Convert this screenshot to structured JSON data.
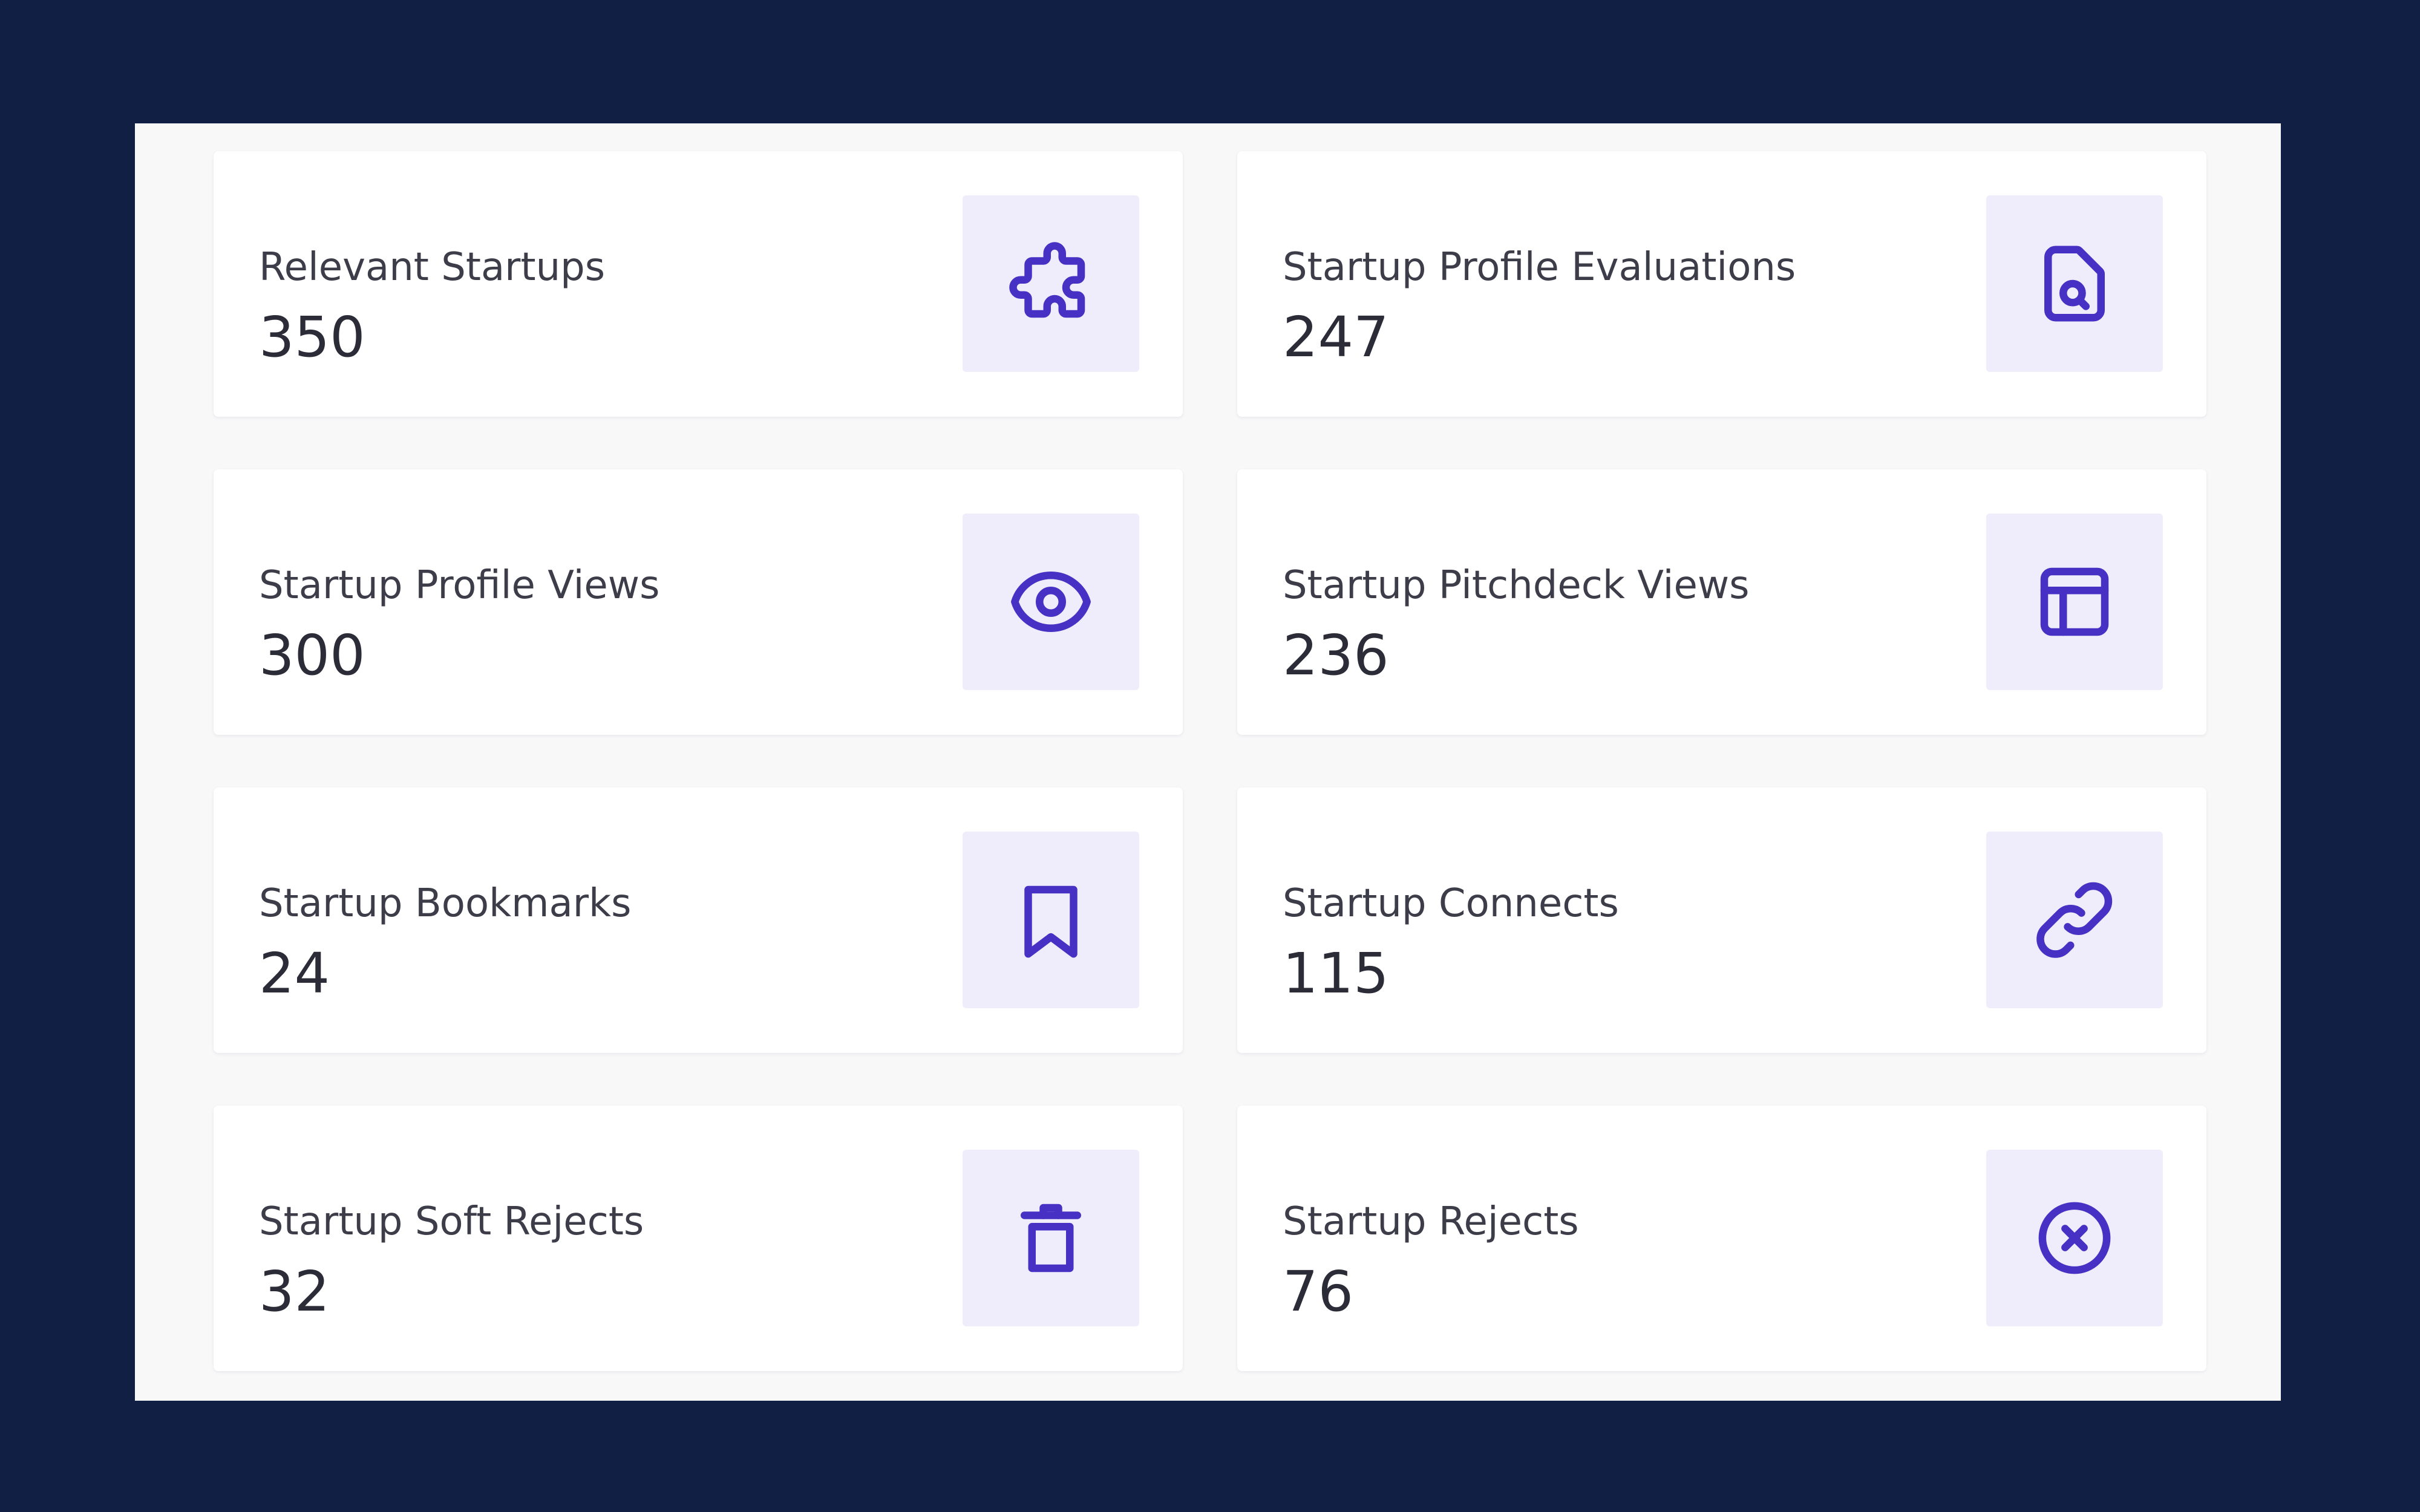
{
  "accent_color": "#4631c4",
  "icon_bg_color": "#efedfb",
  "background_color": "#121f45",
  "stats": [
    {
      "label": "Relevant Startups",
      "value": "350",
      "icon": "puzzle-icon"
    },
    {
      "label": "Startup Profile Evaluations",
      "value": "247",
      "icon": "document-search-icon"
    },
    {
      "label": "Startup Profile Views",
      "value": "300",
      "icon": "eye-icon"
    },
    {
      "label": "Startup Pitchdeck Views",
      "value": "236",
      "icon": "layout-icon"
    },
    {
      "label": "Startup Bookmarks",
      "value": "24",
      "icon": "bookmark-icon"
    },
    {
      "label": "Startup Connects",
      "value": "115",
      "icon": "link-icon"
    },
    {
      "label": "Startup Soft Rejects",
      "value": "32",
      "icon": "trash-icon"
    },
    {
      "label": "Startup Rejects",
      "value": "76",
      "icon": "x-circle-icon"
    }
  ]
}
